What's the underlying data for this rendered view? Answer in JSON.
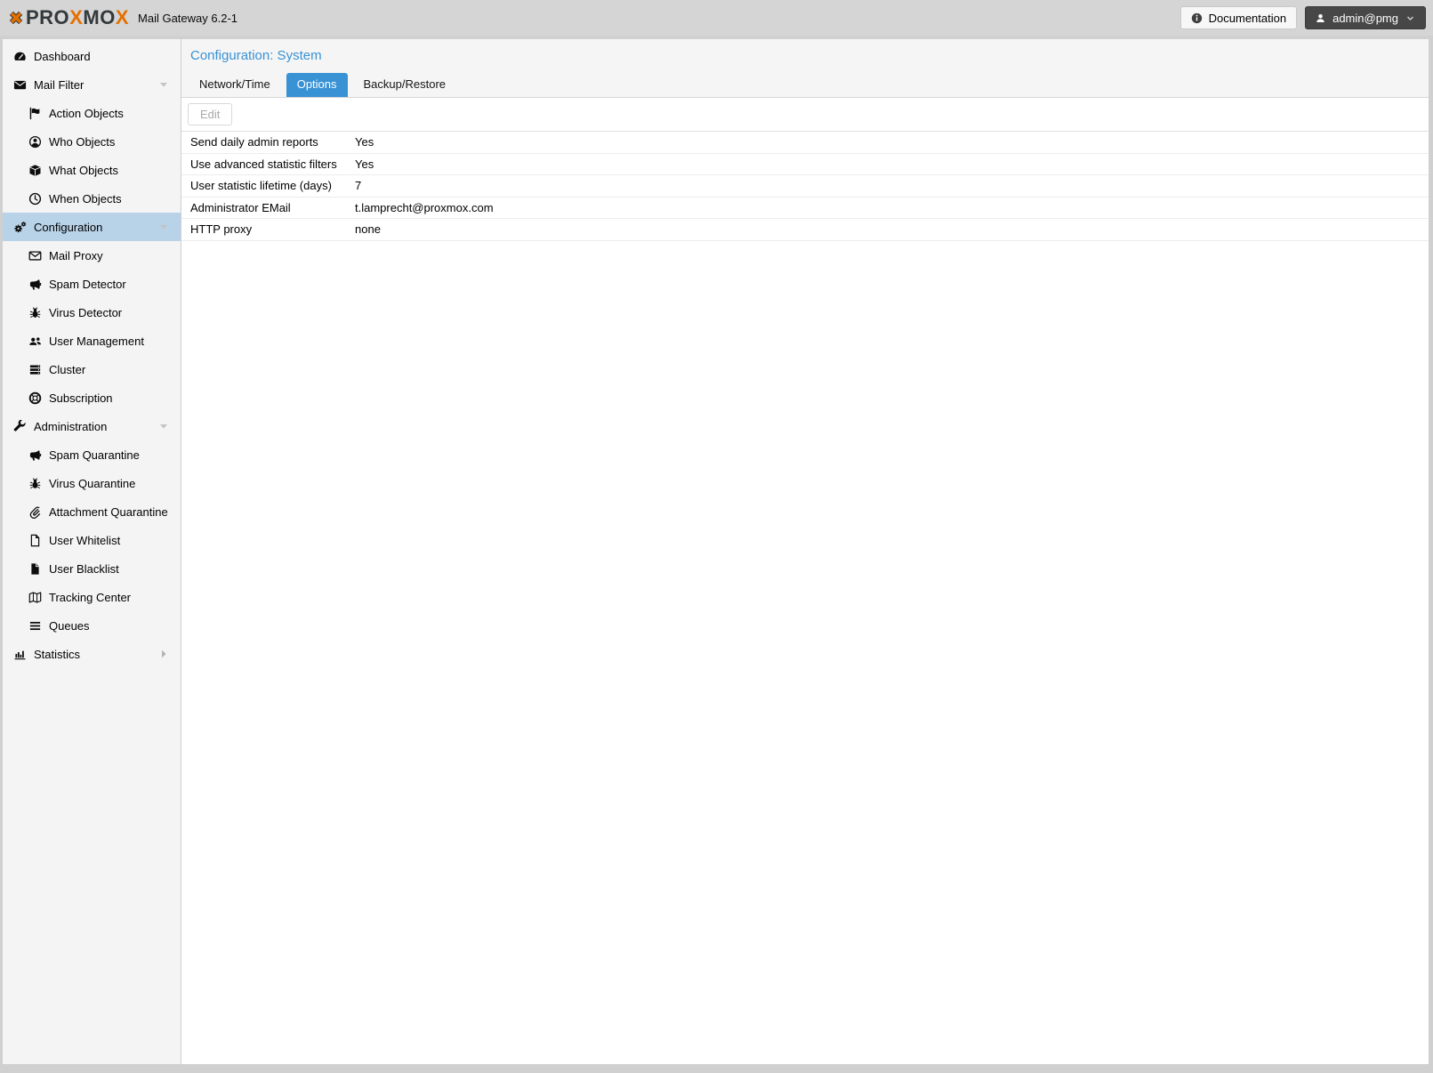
{
  "topbar": {
    "brand": {
      "parts": [
        {
          "text": "PRO",
          "orange": false
        },
        {
          "text": "X",
          "orange": true
        },
        {
          "text": "MO",
          "orange": false
        },
        {
          "text": "X",
          "orange": true
        }
      ]
    },
    "subtitle": "Mail Gateway 6.2-1",
    "documentation_label": "Documentation",
    "user_label": "admin@pmg"
  },
  "sidebar": {
    "items": [
      {
        "label": "Dashboard",
        "icon": "tachometer-icon",
        "level": 1,
        "selected": false,
        "expand": null
      },
      {
        "label": "Mail Filter",
        "icon": "envelope-icon",
        "level": 1,
        "selected": false,
        "expand": "down"
      },
      {
        "label": "Action Objects",
        "icon": "flag-icon",
        "level": 2,
        "selected": false,
        "expand": null
      },
      {
        "label": "Who Objects",
        "icon": "user-circle-icon",
        "level": 2,
        "selected": false,
        "expand": null
      },
      {
        "label": "What Objects",
        "icon": "cube-icon",
        "level": 2,
        "selected": false,
        "expand": null
      },
      {
        "label": "When Objects",
        "icon": "clock-icon",
        "level": 2,
        "selected": false,
        "expand": null
      },
      {
        "label": "Configuration",
        "icon": "cogs-icon",
        "level": 1,
        "selected": true,
        "expand": "down"
      },
      {
        "label": "Mail Proxy",
        "icon": "envelope-open-icon",
        "level": 2,
        "selected": false,
        "expand": null
      },
      {
        "label": "Spam Detector",
        "icon": "bullhorn-icon",
        "level": 2,
        "selected": false,
        "expand": null
      },
      {
        "label": "Virus Detector",
        "icon": "bug-icon",
        "level": 2,
        "selected": false,
        "expand": null
      },
      {
        "label": "User Management",
        "icon": "users-icon",
        "level": 2,
        "selected": false,
        "expand": null
      },
      {
        "label": "Cluster",
        "icon": "server-icon",
        "level": 2,
        "selected": false,
        "expand": null
      },
      {
        "label": "Subscription",
        "icon": "life-ring-icon",
        "level": 2,
        "selected": false,
        "expand": null
      },
      {
        "label": "Administration",
        "icon": "wrench-icon",
        "level": 1,
        "selected": false,
        "expand": "down"
      },
      {
        "label": "Spam Quarantine",
        "icon": "bullhorn-icon",
        "level": 2,
        "selected": false,
        "expand": null
      },
      {
        "label": "Virus Quarantine",
        "icon": "bug-icon",
        "level": 2,
        "selected": false,
        "expand": null
      },
      {
        "label": "Attachment Quarantine",
        "icon": "paperclip-icon",
        "level": 2,
        "selected": false,
        "expand": null
      },
      {
        "label": "User Whitelist",
        "icon": "file-outline-icon",
        "level": 2,
        "selected": false,
        "expand": null
      },
      {
        "label": "User Blacklist",
        "icon": "file-solid-icon",
        "level": 2,
        "selected": false,
        "expand": null
      },
      {
        "label": "Tracking Center",
        "icon": "map-icon",
        "level": 2,
        "selected": false,
        "expand": null
      },
      {
        "label": "Queues",
        "icon": "bars-icon",
        "level": 2,
        "selected": false,
        "expand": null
      },
      {
        "label": "Statistics",
        "icon": "bar-chart-icon",
        "level": 1,
        "selected": false,
        "expand": "right"
      }
    ]
  },
  "content": {
    "title": "Configuration: System",
    "tabs": [
      {
        "label": "Network/Time",
        "active": false
      },
      {
        "label": "Options",
        "active": true
      },
      {
        "label": "Backup/Restore",
        "active": false
      }
    ],
    "toolbar": {
      "edit_label": "Edit",
      "edit_disabled": true
    },
    "options_table": {
      "rows": [
        {
          "label": "Send daily admin reports",
          "value": "Yes"
        },
        {
          "label": "Use advanced statistic filters",
          "value": "Yes"
        },
        {
          "label": "User statistic lifetime (days)",
          "value": "7"
        },
        {
          "label": "Administrator EMail",
          "value": "t.lamprecht@proxmox.com"
        },
        {
          "label": "HTTP proxy",
          "value": "none"
        }
      ]
    }
  },
  "colors": {
    "accent_blue": "#3892d4",
    "brand_orange": "#e57000",
    "brand_dark": "#33393c",
    "selected_nav_bg": "#b8d2e8",
    "topbar_bg": "#d5d5d5",
    "sidebar_bg": "#f4f4f4",
    "user_button_bg": "#474747"
  }
}
